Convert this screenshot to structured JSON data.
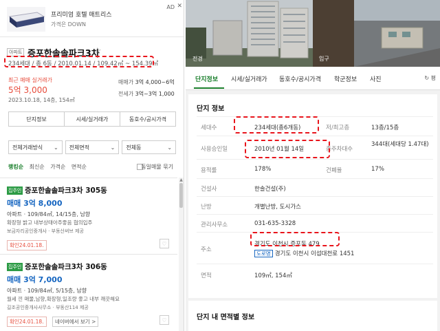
{
  "ad": {
    "badge": "AD",
    "close": "✕",
    "title": "프리미엄 호텔 매트리스",
    "subtitle": "가격은 DOWN"
  },
  "complex": {
    "type_tag": "아파트",
    "name": "증포한솔솔파크3차",
    "info": "234세대 / 총 6동 / 2010.01.14 / 109.42㎡ ~ 154.39㎡",
    "recent_label": "최근 매매 실거래가",
    "recent_price": "5억 3,000",
    "recent_date": "2023.10.18, 14층, 154㎡",
    "sale_label": "매매가",
    "sale_value": "3억 4,000~6억",
    "jeonse_label": "전세가",
    "jeonse_value": "3억~3억 1,000"
  },
  "left_tabs": [
    "단지정보",
    "시세/실거래가",
    "동호수/공시가격"
  ],
  "filters": [
    {
      "label": "전체거래방식"
    },
    {
      "label": "전체면적"
    },
    {
      "label": "전체동"
    }
  ],
  "sort": {
    "options": [
      "랭킹순",
      "최신순",
      "가격순",
      "면적순"
    ],
    "checkbox_label": "동일매물 묶기"
  },
  "listings": [
    {
      "badge": "집주인",
      "title": "증포한솔솔파크3차 305동",
      "price": "매매 3억 8,000",
      "spec": "아파트 · 109/84㎡, 14/15층, 남향",
      "desc": "확장형 밝고 내부상태아주좋음 협의입주",
      "agent": "보금자리공인중개사 · 부동산써브 제공",
      "confirm": "확인24.01.18.",
      "naver": ""
    },
    {
      "badge": "집주인",
      "title": "증포한솔솔파크3차 306동",
      "price": "매매 3억 7,000",
      "spec": "아파트 · 109/84㎡, 5/15층, 남향",
      "desc": "월세 낀 매물,남향,확장형,일조량 좋고 내부 깨끗해요",
      "agent": "길조공인중개사사무소 · 부동산114 제공",
      "confirm": "확인24.01.18.",
      "naver": "네이버에서 보기 >"
    }
  ],
  "right_tabs": [
    "단지정보",
    "시세/실거래가",
    "동호수/공시가격",
    "학군정보",
    "사진"
  ],
  "refresh_label": "평",
  "photo_labels": [
    "전경",
    "입구"
  ],
  "info": {
    "title": "단지 정보",
    "rows": [
      {
        "k": "세대수",
        "v": "234세대(총6개동)",
        "k2": "저/최고층",
        "v2": "13층/15층"
      },
      {
        "k": "사용승인일",
        "v": "2010년 01월 14일",
        "k2": "총주차대수",
        "v2": "344대(세대당 1.47대)"
      },
      {
        "k": "용적률",
        "v": "178%",
        "k2": "건폐율",
        "v2": "17%"
      },
      {
        "k": "건설사",
        "v": "한솔건설(주)"
      },
      {
        "k": "난방",
        "v": "개별난방, 도시가스"
      },
      {
        "k": "관리사무소",
        "v": "031-635-3328"
      },
      {
        "k": "주소",
        "v": "경기도 이천시 증포동 479",
        "road_tag": "도로명",
        "v_road": "경기도 이천시 이섭대천로 1451"
      },
      {
        "k": "면적",
        "v": "109㎡, 154㎡"
      }
    ]
  },
  "area_title": "단지 내 면적별 정보"
}
